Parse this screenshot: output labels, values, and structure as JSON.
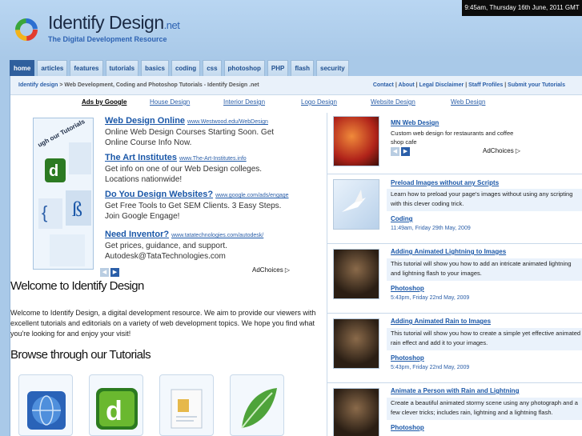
{
  "header": {
    "title": "Identify Design",
    "tld": ".net",
    "tagline": "The Digital Development Resource",
    "clock": "9:45am, Thursday 16th June, 2011 GMT"
  },
  "nav": {
    "tabs": [
      {
        "label": "home",
        "active": true
      },
      {
        "label": "articles"
      },
      {
        "label": "features"
      },
      {
        "label": "tutorials"
      },
      {
        "label": "basics"
      },
      {
        "label": "coding"
      },
      {
        "label": "css"
      },
      {
        "label": "photoshop"
      },
      {
        "label": "PHP"
      },
      {
        "label": "flash"
      },
      {
        "label": "security"
      }
    ]
  },
  "breadcrumb": {
    "home": "Identify design",
    "separator": ">",
    "current": "Web Development, Coding and Photoshop Tutorials - Identify Design .net"
  },
  "top_links": [
    "Contact",
    "About",
    "Legal Disclaimer",
    "Staff Profiles",
    "Submit your Tutorials"
  ],
  "ad_links": {
    "ads_by": "Ads by Google",
    "items": [
      "House Design",
      "Interior Design",
      "Logo Design",
      "Website Design",
      "Web Design"
    ]
  },
  "ads": [
    {
      "title": "Web Design Online",
      "url": "www.Westwood.edu/WebDesign",
      "desc": "Online Web Design Courses Starting Soon. Get Online Course Info Now."
    },
    {
      "title": "The Art Institutes",
      "url": "www.The-Art-Institutes.info",
      "desc": "Get info on one of our Web Design colleges. Locations nationwide!"
    },
    {
      "title": "Do You Design Websites?",
      "url": "www.google.com/ads/engage",
      "desc": "Get Free Tools to Get SEM Clients. 3 Easy Steps. Join Google Engage!"
    },
    {
      "title": "Need Inventor?",
      "url": "www.tatatechnologies.com/autodesk/",
      "desc": "Get prices, guidance, and support. Autodesk@TataTechnologies.com"
    }
  ],
  "ad_image_text": "ugh our Tutorials",
  "adchoices": "AdChoices",
  "welcome": {
    "heading": "Welcome to Identify Design",
    "text": "Welcome to Identify Design, a digital development resource. We aim to provide our viewers with excellent tutorials and editorials on a variety of web development topics. We hope you find what you're looking for and enjoy your visit!"
  },
  "browse_heading": "Browse through our Tutorials",
  "tutorial_icons": [
    "globe-icon",
    "dreamweaver-icon",
    "document-icon",
    "leaf-icon"
  ],
  "sidebar": {
    "ad": {
      "title": "MN Web Design",
      "desc": "Custom web design for restaurants and coffee shop cafe"
    },
    "articles": [
      {
        "title": "Preload Images without any Scripts",
        "desc": "Learn how to preload your page's images without using any scripting with this clever coding trick.",
        "category": "Coding",
        "date": "11:49am, Friday 29th May, 2009"
      },
      {
        "title": "Adding Animated Lightning to Images",
        "desc": "This tutorial will show you how to add an intricate animated lightning and lightning flash to your images.",
        "category": "Photoshop",
        "date": "5:43pm, Friday 22nd May, 2009"
      },
      {
        "title": "Adding Animated Rain to Images",
        "desc": "This tutorial will show you how to create a simple yet effective animated rain effect and add it to your images.",
        "category": "Photoshop",
        "date": "5:43pm, Friday 22nd May, 2009"
      },
      {
        "title": "Animate a Person with Rain and Lightning",
        "desc": "Create a beautiful animated stormy scene using any photograph and a few clever tricks; includes rain, lightning and a lightning flash.",
        "category": "Photoshop",
        "date": ""
      }
    ]
  },
  "colors": {
    "accent": "#2a5ea8",
    "header_bg": "#a9c9e8",
    "nav_active": "#2f5f9d"
  }
}
